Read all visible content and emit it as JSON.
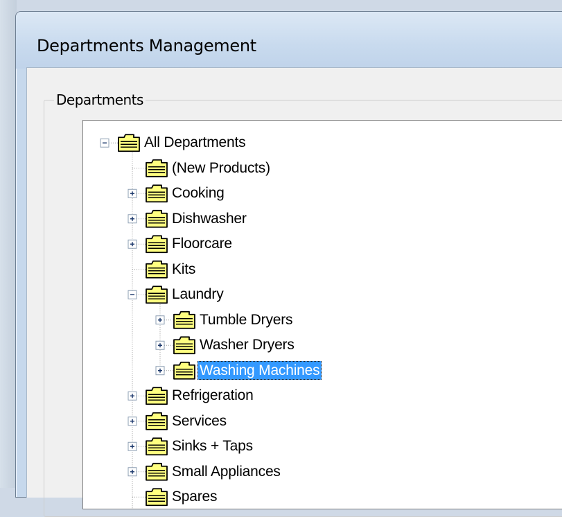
{
  "window": {
    "title": "Departments Management"
  },
  "group": {
    "label": "Departments"
  },
  "tree": {
    "nodes": [
      {
        "label": "All Departments",
        "depth": 0,
        "expander": "minus"
      },
      {
        "label": "(New Products)",
        "depth": 1,
        "expander": "none"
      },
      {
        "label": "Cooking",
        "depth": 1,
        "expander": "plus"
      },
      {
        "label": "Dishwasher",
        "depth": 1,
        "expander": "plus"
      },
      {
        "label": "Floorcare",
        "depth": 1,
        "expander": "plus"
      },
      {
        "label": "Kits",
        "depth": 1,
        "expander": "none"
      },
      {
        "label": "Laundry",
        "depth": 1,
        "expander": "minus"
      },
      {
        "label": "Tumble Dryers",
        "depth": 2,
        "expander": "plus"
      },
      {
        "label": "Washer Dryers",
        "depth": 2,
        "expander": "plus"
      },
      {
        "label": "Washing Machines",
        "depth": 2,
        "expander": "plus",
        "selected": true
      },
      {
        "label": "Refrigeration",
        "depth": 1,
        "expander": "plus"
      },
      {
        "label": "Services",
        "depth": 1,
        "expander": "plus"
      },
      {
        "label": "Sinks + Taps",
        "depth": 1,
        "expander": "plus"
      },
      {
        "label": "Small Appliances",
        "depth": 1,
        "expander": "plus"
      },
      {
        "label": "Spares",
        "depth": 1,
        "expander": "none"
      }
    ],
    "icon": "folder-icon",
    "selection_color": "#3399ff",
    "folder_color": "#ffff80"
  }
}
